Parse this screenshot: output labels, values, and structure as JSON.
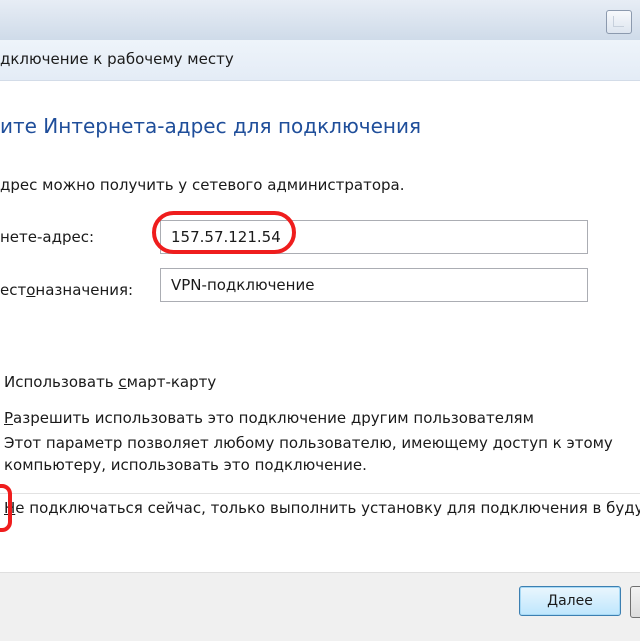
{
  "window": {
    "title": "дключение к рабочему месту"
  },
  "heading": "ите Интернета-адрес для подключения",
  "info_text": "дрес можно получить у сетевого администратора.",
  "fields": {
    "address_label": "нете-адрес:",
    "address_value": "157.57.121.54",
    "dest_label_pre": "ест",
    "dest_label_ul": "о",
    "dest_label_post": "назначения:",
    "dest_value": "VPN-подключение"
  },
  "options": {
    "smartcard_pre": "Использовать ",
    "smartcard_ul": "с",
    "smartcard_post": "март-карту",
    "allow_ul": "Р",
    "allow_post": "азрешить использовать это подключение другим пользователям",
    "allow_desc": "Этот параметр позволяет любому пользователю, имеющему доступ к этому компьютеру, использовать это подключение.",
    "dont_connect_ul": "Н",
    "dont_connect_post": "е подключаться сейчас, только выполнить установку для подключения в будущ"
  },
  "buttons": {
    "next_ul": "Д",
    "next_post": "алее"
  },
  "colors": {
    "heading": "#1f4e9a",
    "annotation": "#ef1d1d"
  }
}
